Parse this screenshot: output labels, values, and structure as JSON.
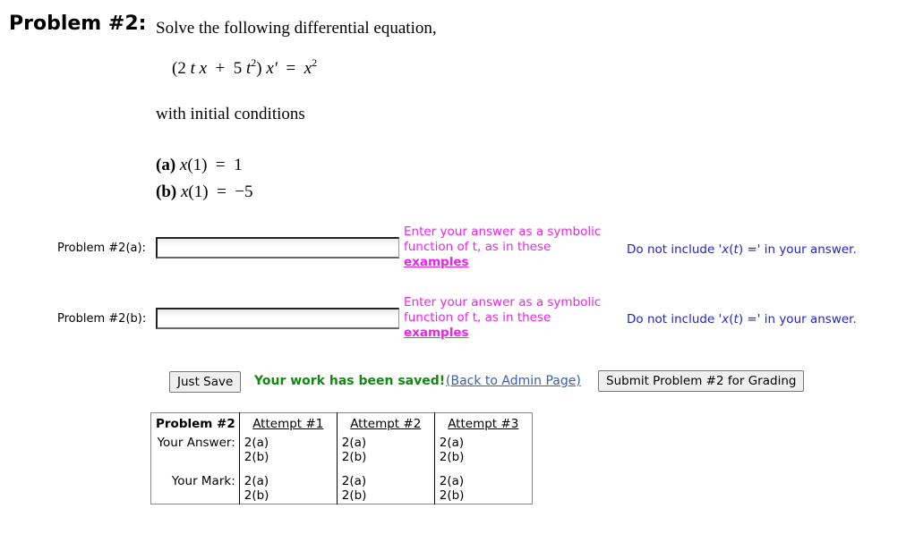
{
  "problem": {
    "title": "Problem #2:",
    "intro": "Solve the following differential equation,",
    "equation": {
      "lhs_open": "(2",
      "t1": "t",
      "x1": "x",
      "plus": "+",
      "five": "5",
      "t2": "t",
      "t2_exp": "2",
      "close": ")",
      "xprime": "x′",
      "equals": "=",
      "rhs": "x",
      "rhs_exp": "2"
    },
    "initial_conditions_label": "with initial conditions",
    "conditions": [
      {
        "label": "(a)",
        "fn": "x",
        "arg": "(1)",
        "eq": "=",
        "value": "1"
      },
      {
        "label": "(b)",
        "fn": "x",
        "arg": "(1)",
        "eq": "=",
        "value": "−5"
      }
    ]
  },
  "answers": [
    {
      "label": "Problem #2(a):",
      "value": "",
      "hint": "Enter your answer as a symbolic function of t, as in these",
      "hint_link": "examples",
      "note_pre": "Do not include '",
      "note_fn": "x",
      "note_paren_open": "(",
      "note_var": "t",
      "note_post": ") =' in your answer."
    },
    {
      "label": "Problem #2(b):",
      "value": "",
      "hint": "Enter your answer as a symbolic function of t, as in these",
      "hint_link": "examples",
      "note_pre": "Do not include '",
      "note_fn": "x",
      "note_paren_open": "(",
      "note_var": "t",
      "note_post": ") =' in your answer."
    }
  ],
  "actions": {
    "just_save": "Just Save",
    "saved_message": "Your work has been saved!",
    "back_link": "(Back to Admin Page)",
    "submit": "Submit Problem #2 for Grading"
  },
  "attempts_table": {
    "header": "Problem #2",
    "columns": [
      "Attempt #1",
      "Attempt #2",
      "Attempt #3"
    ],
    "rows": [
      {
        "label": "Your Answer:",
        "cells": [
          [
            "2(a)",
            "2(b)"
          ],
          [
            "2(a)",
            "2(b)"
          ],
          [
            "2(a)",
            "2(b)"
          ]
        ]
      },
      {
        "label": "Your Mark:",
        "cells": [
          [
            "2(a)",
            "2(b)"
          ],
          [
            "2(a)",
            "2(b)"
          ],
          [
            "2(a)",
            "2(b)"
          ]
        ]
      }
    ]
  },
  "colors": {
    "hint": "#ee22ee",
    "note": "#2222cc",
    "saved": "#118811",
    "link": "#3a5ea8"
  }
}
